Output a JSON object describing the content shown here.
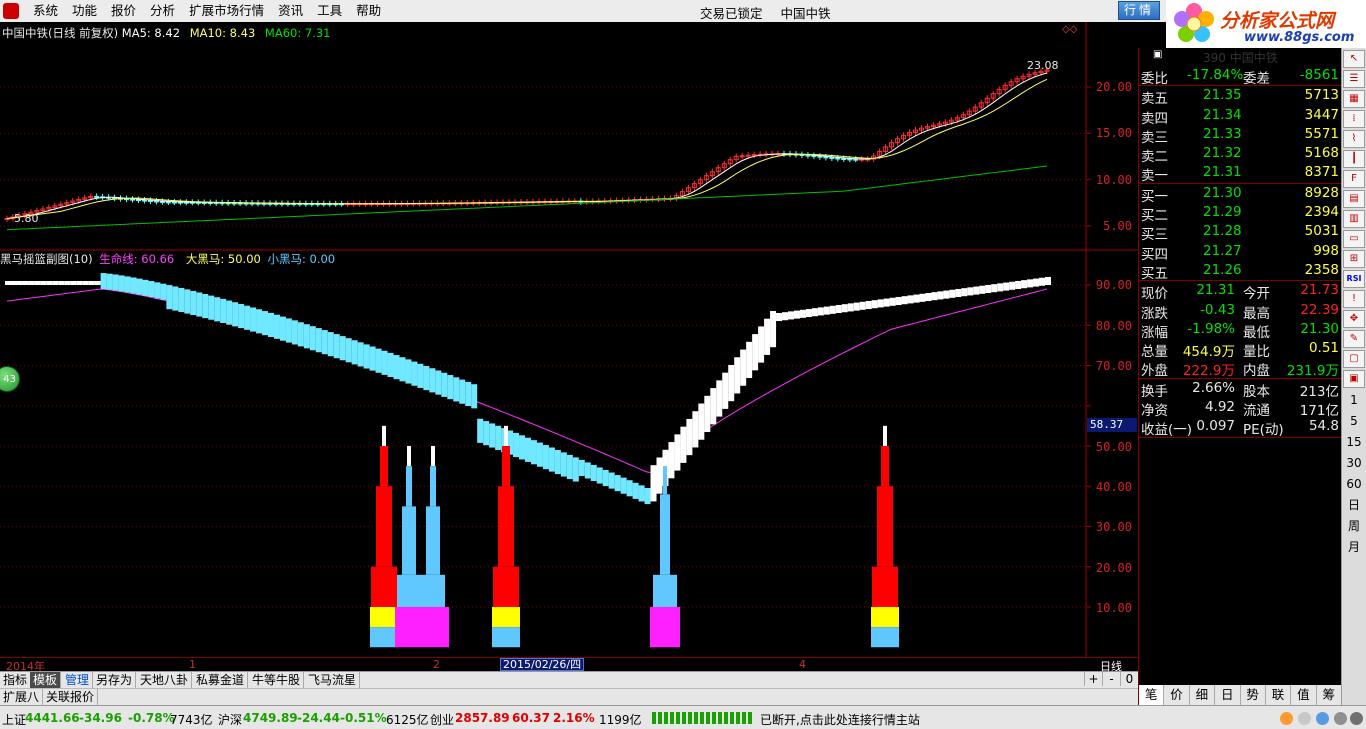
{
  "menubar": {
    "items": [
      "系统",
      "功能",
      "报价",
      "分析",
      "扩展市场行情",
      "资讯",
      "工具",
      "帮助"
    ],
    "status": "交易已锁定",
    "stock": "中国中铁",
    "hq_button": "行情"
  },
  "logo": {
    "title": "分析家公式网",
    "url": "www.88gs.com"
  },
  "main_chart": {
    "header_name": "中国中铁(日线 前复权)",
    "ma5_label": "MA5: 8.42",
    "ma10_label": "MA10: 8.43",
    "ma60_label": "MA60: 7.31",
    "high_marker": "23.08",
    "low_marker": "5.80",
    "y_ticks": [
      "20.00",
      "15.00",
      "10.00",
      "5.00"
    ],
    "colors": {
      "ma5": "#ffffff",
      "ma10": "#ffff60",
      "ma60": "#00c000",
      "up": "#ff3030",
      "down": "#60ffff"
    }
  },
  "sub_chart": {
    "header_name": "黑马摇篮副图(10)",
    "life_line": "生命线: 60.66",
    "big_horse": "大黑马: 50.00",
    "small_horse": "小黑马: 0.00",
    "y_ticks": [
      "90.00",
      "80.00",
      "70.00",
      "60.00",
      "50.00",
      "40.00",
      "30.00",
      "20.00",
      "10.00"
    ],
    "current_value": "58.37",
    "bubble_value": "43"
  },
  "time_axis": {
    "labels": [
      "2014年",
      "1",
      "2",
      "2015/02/26/四",
      "4"
    ],
    "period": "日线"
  },
  "tabs1": {
    "items": [
      "指标",
      "模板",
      "管理",
      "另存为",
      "天地八卦",
      "私募金道",
      "牛等牛股",
      "飞马流星"
    ],
    "controls": [
      "+",
      "-",
      "0"
    ]
  },
  "tabs2": {
    "items": [
      "扩展八",
      "关联报价"
    ]
  },
  "quote": {
    "header": "390 中国中铁",
    "weibi_label": "委比",
    "weibi_value": "-17.84%",
    "weicha_label": "委差",
    "weicha_value": "-8561",
    "asks": [
      {
        "label": "卖五",
        "price": "21.35",
        "vol": "5713"
      },
      {
        "label": "卖四",
        "price": "21.34",
        "vol": "3447"
      },
      {
        "label": "卖三",
        "price": "21.33",
        "vol": "5571"
      },
      {
        "label": "卖二",
        "price": "21.32",
        "vol": "5168"
      },
      {
        "label": "卖一",
        "price": "21.31",
        "vol": "8371"
      }
    ],
    "bids": [
      {
        "label": "买一",
        "price": "21.30",
        "vol": "8928"
      },
      {
        "label": "买二",
        "price": "21.29",
        "vol": "2394"
      },
      {
        "label": "买三",
        "price": "21.28",
        "vol": "5031"
      },
      {
        "label": "买四",
        "price": "21.27",
        "vol": "998"
      },
      {
        "label": "买五",
        "price": "21.26",
        "vol": "2358"
      }
    ],
    "stats": [
      {
        "l1": "现价",
        "v1": "21.31",
        "l2": "今开",
        "v2": "21.73"
      },
      {
        "l1": "涨跌",
        "v1": "-0.43",
        "l2": "最高",
        "v2": "22.39"
      },
      {
        "l1": "涨幅",
        "v1": "-1.98%",
        "l2": "最低",
        "v2": "21.30"
      },
      {
        "l1": "总量",
        "v1": "454.9万",
        "l2": "量比",
        "v2": "0.51"
      },
      {
        "l1": "外盘",
        "v1": "222.9万",
        "l2": "内盘",
        "v2": "231.9万"
      }
    ],
    "fund": [
      {
        "l1": "换手",
        "v1": "2.66%",
        "l2": "股本",
        "v2": "213亿"
      },
      {
        "l1": "净资",
        "v1": "4.92",
        "l2": "流通",
        "v2": "171亿"
      },
      {
        "l1": "收益(一)",
        "v1": "0.097",
        "l2": "PE(动)",
        "v2": "54.8"
      }
    ],
    "bottom_tabs": [
      "笔",
      "价",
      "细",
      "日",
      "势",
      "联",
      "值",
      "筹"
    ]
  },
  "toolstrip": {
    "buttons": [
      "RSI"
    ],
    "numbers": [
      "1",
      "5",
      "15",
      "30",
      "60",
      "日",
      "周",
      "月"
    ]
  },
  "statusbar": {
    "sh_label": "上证",
    "sh_value": "4441.66",
    "sh_change": "-34.96",
    "sh_pct": "-0.78%",
    "sh_amt": "7743亿",
    "sz_label": "沪深",
    "sz_value": "4749.89",
    "sz_change": "-24.44",
    "sz_pct": "-0.51%",
    "sz_amt": "6125亿",
    "cy_label": "创业",
    "cy_value": "2857.89",
    "cy_change": "60.37",
    "cy_pct": "2.16%",
    "cy_amt": "1199亿",
    "message": "已断开,点击此处连接行情主站"
  }
}
